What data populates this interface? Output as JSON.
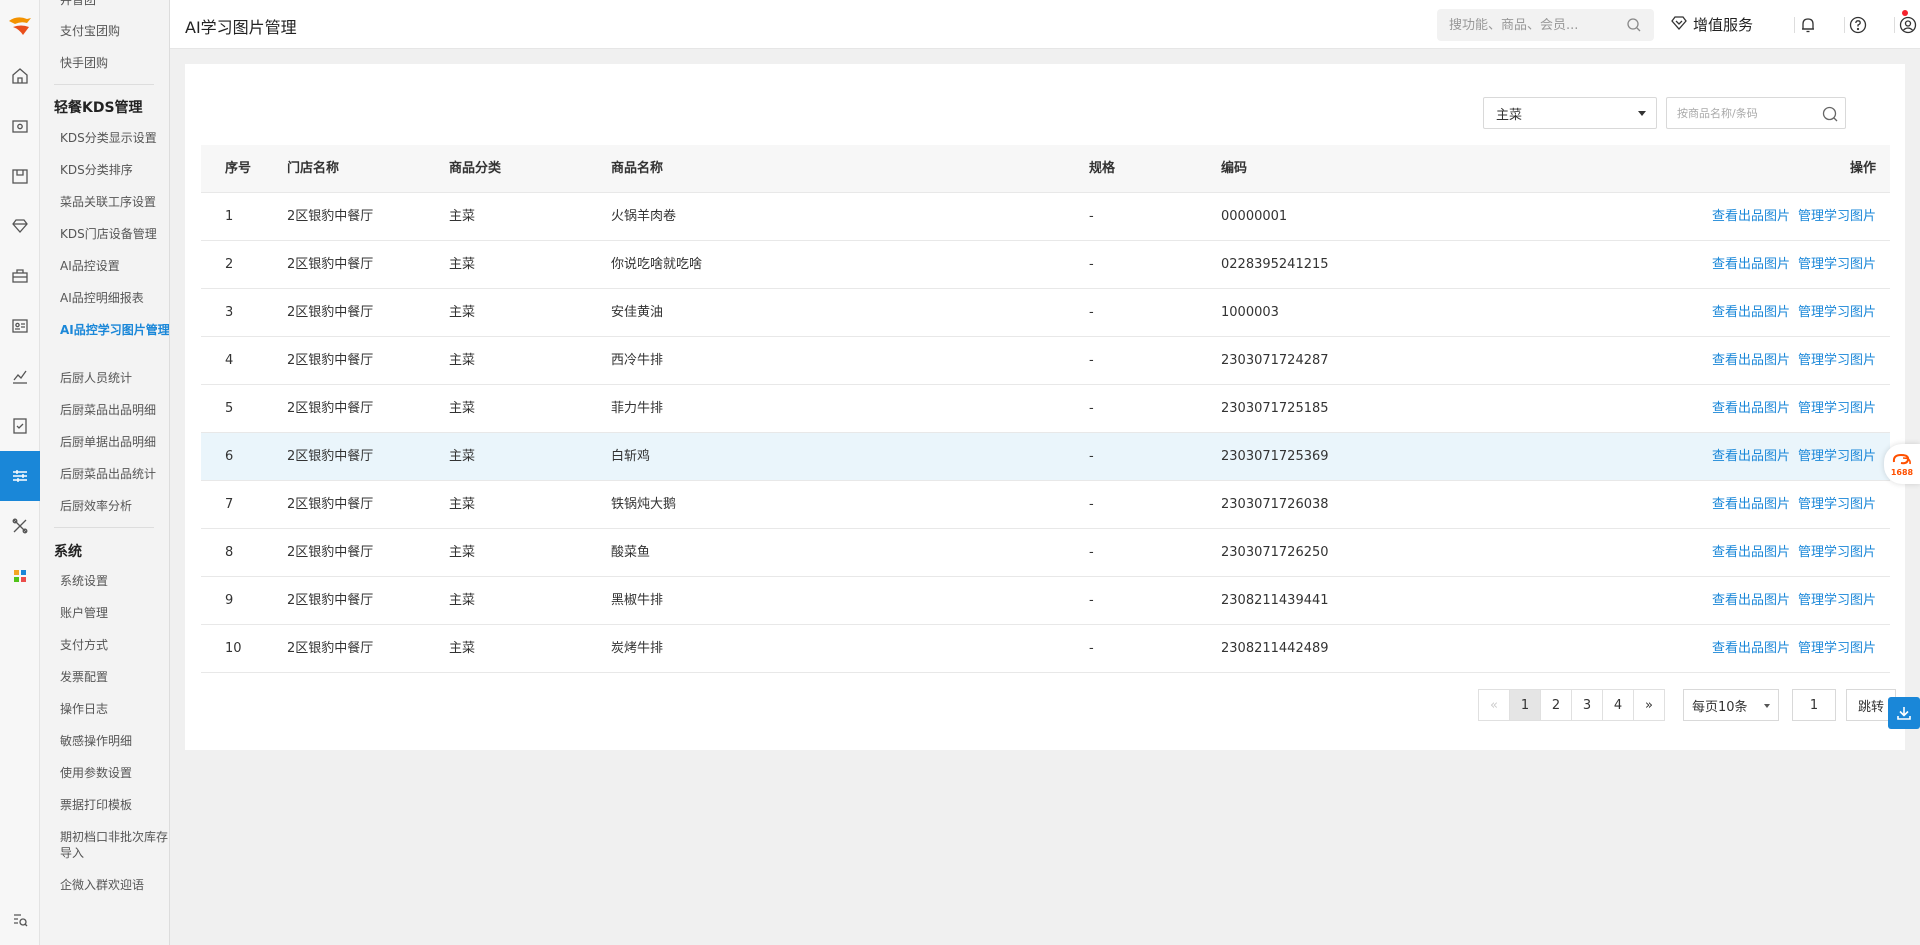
{
  "header": {
    "title": "AI学习图片管理",
    "search_placeholder": "搜功能、商品、会员...",
    "value_added_service": "增值服务"
  },
  "sidebar": {
    "items_top": [
      "井普团",
      "支付宝团购",
      "快手团购"
    ],
    "group_kds": "轻餐KDS管理",
    "items_kds": [
      "KDS分类显示设置",
      "KDS分类排序",
      "菜品关联工序设置",
      "KDS门店设备管理",
      "AI品控设置",
      "AI品控明细报表",
      "AI品控学习图片管理",
      "后厨人员统计",
      "后厨菜品出品明细",
      "后厨单据出品明细",
      "后厨菜品出品统计",
      "后厨效率分析"
    ],
    "group_system": "系统",
    "items_system": [
      "系统设置",
      "账户管理",
      "支付方式",
      "发票配置",
      "操作日志",
      "敏感操作明细",
      "使用参数设置",
      "票据打印模板",
      "期初档口非批次库存导入",
      "企微入群欢迎语"
    ]
  },
  "filters": {
    "category_selected": "主菜",
    "product_search_placeholder": "按商品名称/条码"
  },
  "table": {
    "headers": {
      "no": "序号",
      "store": "门店名称",
      "category": "商品分类",
      "name": "商品名称",
      "spec": "规格",
      "code": "编码",
      "op": "操作"
    },
    "action_view": "查看出品图片",
    "action_manage": "管理学习图片",
    "rows": [
      {
        "no": "1",
        "store": "2区银豹中餐厅",
        "category": "主菜",
        "name": "火锅羊肉卷",
        "spec": "-",
        "code": "00000001"
      },
      {
        "no": "2",
        "store": "2区银豹中餐厅",
        "category": "主菜",
        "name": "你说吃啥就吃啥",
        "spec": "-",
        "code": "0228395241215"
      },
      {
        "no": "3",
        "store": "2区银豹中餐厅",
        "category": "主菜",
        "name": "安佳黄油",
        "spec": "-",
        "code": "1000003"
      },
      {
        "no": "4",
        "store": "2区银豹中餐厅",
        "category": "主菜",
        "name": "西冷牛排",
        "spec": "-",
        "code": "2303071724287"
      },
      {
        "no": "5",
        "store": "2区银豹中餐厅",
        "category": "主菜",
        "name": "菲力牛排",
        "spec": "-",
        "code": "2303071725185"
      },
      {
        "no": "6",
        "store": "2区银豹中餐厅",
        "category": "主菜",
        "name": "白斩鸡",
        "spec": "-",
        "code": "2303071725369"
      },
      {
        "no": "7",
        "store": "2区银豹中餐厅",
        "category": "主菜",
        "name": "铁锅炖大鹅",
        "spec": "-",
        "code": "2303071726038"
      },
      {
        "no": "8",
        "store": "2区银豹中餐厅",
        "category": "主菜",
        "name": "酸菜鱼",
        "spec": "-",
        "code": "2303071726250"
      },
      {
        "no": "9",
        "store": "2区银豹中餐厅",
        "category": "主菜",
        "name": "黑椒牛排",
        "spec": "-",
        "code": "2308211439441"
      },
      {
        "no": "10",
        "store": "2区银豹中餐厅",
        "category": "主菜",
        "name": "炭烤牛排",
        "spec": "-",
        "code": "2308211442489"
      }
    ]
  },
  "pagination": {
    "prev": "«",
    "pages": [
      "1",
      "2",
      "3",
      "4"
    ],
    "next": "»",
    "page_size": "每页10条",
    "jump_value": "1",
    "jump_label": "跳转"
  },
  "float": {
    "badge_1688": "1688"
  },
  "colors": {
    "accent": "#1a87d8",
    "highlight_row": "#eaf5fb",
    "notification_dot": "#f5222d"
  }
}
